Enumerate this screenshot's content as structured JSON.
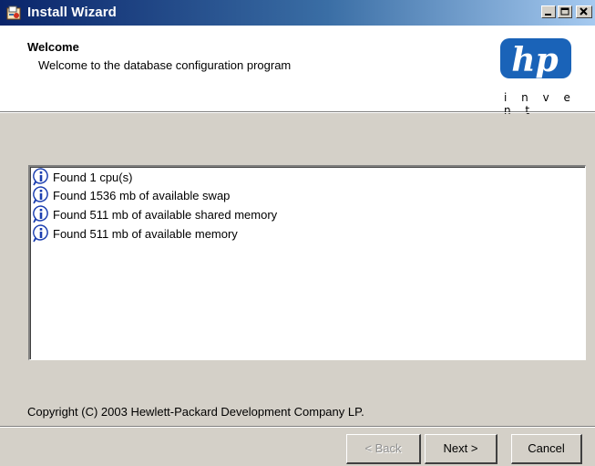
{
  "window": {
    "title": "Install Wizard",
    "icon": "installer-icon"
  },
  "title_buttons": {
    "minimize_icon": "minimize-icon",
    "maximize_icon": "maximize-icon",
    "close_icon": "close-icon"
  },
  "banner": {
    "heading": "Welcome",
    "subtitle": "Welcome to the database configuration program",
    "logo": {
      "text": "hp",
      "tagline": "i n v e n t",
      "registered": "®",
      "color": "#1a63b8"
    }
  },
  "messages": [
    {
      "icon": "info-icon",
      "text": "Found 1 cpu(s)"
    },
    {
      "icon": "info-icon",
      "text": "Found 1536 mb of available swap"
    },
    {
      "icon": "info-icon",
      "text": "Found 511 mb of available shared memory"
    },
    {
      "icon": "info-icon",
      "text": "Found 511 mb of available memory"
    }
  ],
  "copyright": "Copyright (C) 2003 Hewlett-Packard Development Company LP.",
  "buttons": {
    "back": {
      "label": "< Back",
      "enabled": false
    },
    "next": {
      "label": "Next >",
      "enabled": true
    },
    "cancel": {
      "label": "Cancel",
      "enabled": true
    }
  },
  "colors": {
    "titlebar_start": "#0a246a",
    "titlebar_end": "#a6caf0",
    "face": "#d4d0c8",
    "info_icon": "#1c3fb0"
  }
}
